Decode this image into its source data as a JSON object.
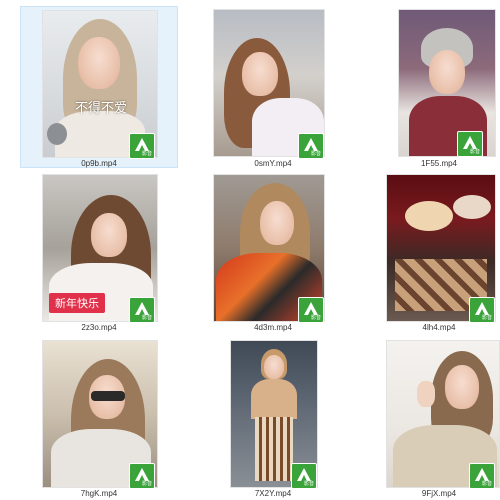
{
  "files": [
    {
      "name": "0p9b.mp4",
      "caption": "不得不爱",
      "banner": "",
      "selected": true
    },
    {
      "name": "0smY.mp4",
      "caption": "",
      "banner": "",
      "selected": false
    },
    {
      "name": "1F55.mp4",
      "caption": "",
      "banner": "",
      "selected": false
    },
    {
      "name": "2z3o.mp4",
      "caption": "",
      "banner": "新年快乐",
      "selected": false
    },
    {
      "name": "4d3m.mp4",
      "caption": "",
      "banner": "",
      "selected": false
    },
    {
      "name": "4lh4.mp4",
      "caption": "",
      "banner": "",
      "selected": false
    },
    {
      "name": "7hgK.mp4",
      "caption": "",
      "banner": "",
      "selected": false
    },
    {
      "name": "7X2Y.mp4",
      "caption": "",
      "banner": "",
      "selected": false
    },
    {
      "name": "9FjX.mp4",
      "caption": "",
      "banner": "",
      "selected": false
    }
  ],
  "badge_icon": "video-player-app-icon",
  "badge_color": "#3aa33a",
  "selection_color": "#e5f1fb"
}
